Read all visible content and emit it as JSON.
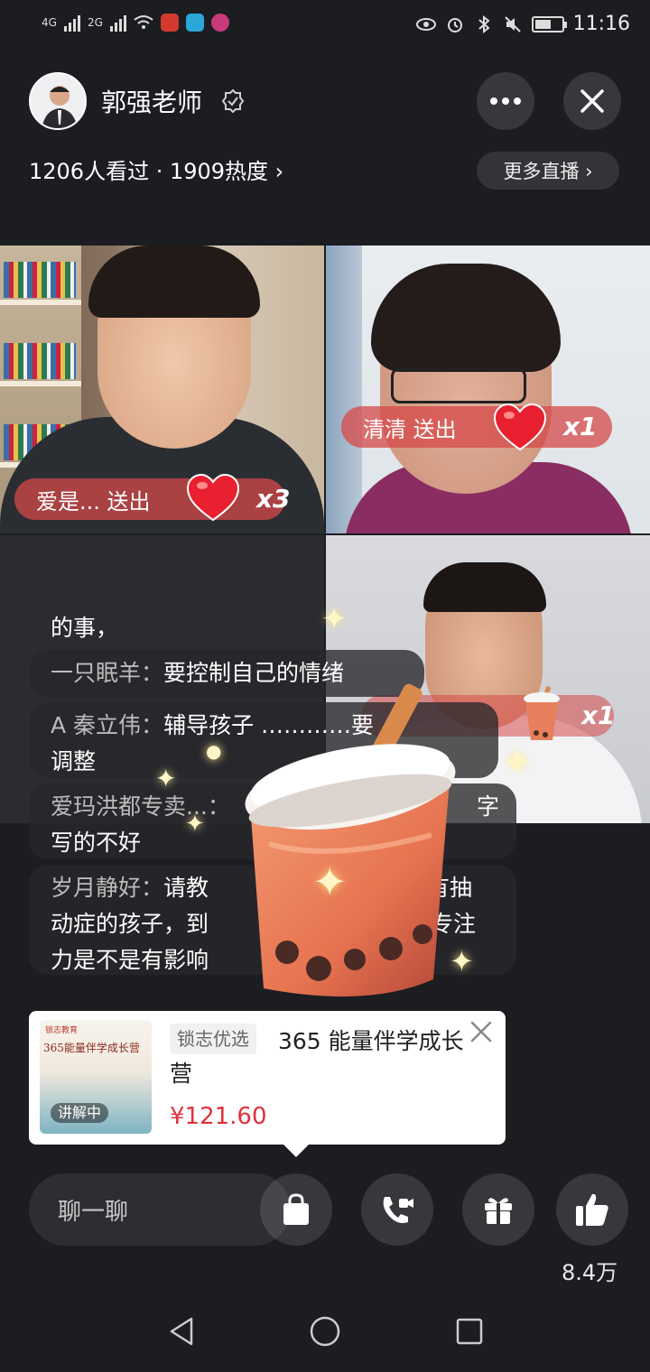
{
  "status_bar": {
    "network_1": "4G",
    "network_2": "2G",
    "time": "11:16",
    "battery_level": 0.6
  },
  "header": {
    "host_name": "郭强老师",
    "stats": "1206人看过 · 1909热度 ›",
    "more_live": "更多直播 ›"
  },
  "gifts": [
    {
      "sender": "爱是... 送出",
      "count": "x3"
    },
    {
      "sender": "清清 送出",
      "count": "x1"
    },
    {
      "count": "x1"
    }
  ],
  "comments": {
    "first_line": "的事，",
    "items": [
      {
        "user": "一只眠羊：",
        "text": "要控制自己的情绪"
      },
      {
        "user": "A 秦立伟：",
        "text": "辅导孩子 …………要",
        "line2": "调整"
      },
      {
        "user": "爱玛洪都专卖...：",
        "text": "",
        "tail": "字",
        "line2": "写的不好"
      },
      {
        "user": "岁月静好：",
        "text": "请教",
        "tail": "侯有抽",
        "line2": "动症的孩子，到",
        "line2_tail": "，专注",
        "line3": "力是不是有影响"
      }
    ]
  },
  "product": {
    "shop_tag": "锁志优选",
    "title": "365 能量伴学成长营",
    "price": "¥121.60",
    "explain_tag": "讲解中",
    "thumb_title": "365能量伴学成长营",
    "thumb_logo": "锁志教育"
  },
  "bottom_bar": {
    "chat_placeholder": "聊一聊",
    "like_count": "8.4万"
  },
  "colors": {
    "gift_pill": "#d64848",
    "price": "#e0303c",
    "heart": "#e8202f"
  },
  "icons": [
    "more-icon",
    "close-icon",
    "verified-icon",
    "heart-icon",
    "bubble-tea-icon",
    "shopping-bag-icon",
    "video-call-icon",
    "gift-icon",
    "thumbs-up-icon",
    "back-nav-icon",
    "home-nav-icon",
    "recents-nav-icon"
  ]
}
